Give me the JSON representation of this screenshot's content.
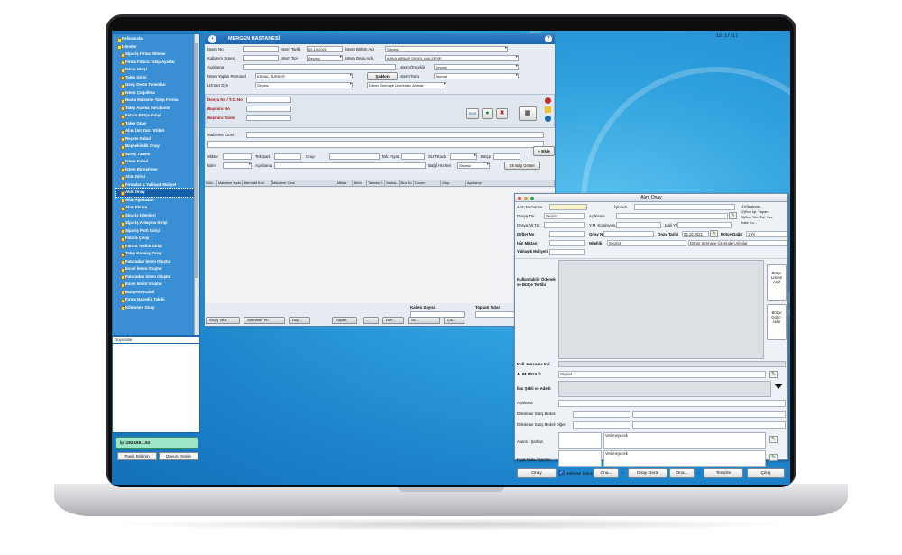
{
  "clock": "15:17:17",
  "nav": {
    "items": [
      {
        "label": "Referanslar",
        "root": true
      },
      {
        "label": "İşlemler",
        "root": true
      },
      {
        "label": "Sipariş Firma Ekleme"
      },
      {
        "label": "Firma Fatura Takip Ayarlar"
      },
      {
        "label": "İstem Girişi"
      },
      {
        "label": "Talep Girişi"
      },
      {
        "label": "Genç Deste Tanımları"
      },
      {
        "label": "İstem Çoğaltma"
      },
      {
        "label": "Hasta Malzeme Talep Formu"
      },
      {
        "label": "Talep Aşama Sorulandır"
      },
      {
        "label": "Fatura Bütçe Girişi"
      },
      {
        "label": "Talep Onay"
      },
      {
        "label": "Alım Üst Yazı / Etiket"
      },
      {
        "label": "Reçete Kabul"
      },
      {
        "label": "Başhekimlik Onay"
      },
      {
        "label": "Süreç Tanımı"
      },
      {
        "label": "İstem Kabul"
      },
      {
        "label": "İstem Birleştirme"
      },
      {
        "label": "Alım Girişi"
      },
      {
        "label": "Firmalar & Yaklaşık Maliyet"
      },
      {
        "label": "Alım Onay",
        "selected": true
      },
      {
        "label": "Alım Aşamaları"
      },
      {
        "label": "Alım Ekranı"
      },
      {
        "label": "Sipariş İşlemleri"
      },
      {
        "label": "Sipariş Anlaşma Girişi"
      },
      {
        "label": "Sipariş Parti Girişi"
      },
      {
        "label": "Fatura Çıkışı"
      },
      {
        "label": "Fatura Teslim Girişi"
      },
      {
        "label": "Talep Komisy Onay"
      },
      {
        "label": "Faturadan İstem Oluştur"
      },
      {
        "label": "Excel İstem Oluştur"
      },
      {
        "label": "Faturadan İstem Oluştur"
      },
      {
        "label": "Excel İstem Oluştur"
      },
      {
        "label": "Muayene Kabul"
      },
      {
        "label": "Firma Hakediş Takibi"
      },
      {
        "label": "Kilometre Onay"
      }
    ]
  },
  "notices_label": "Duyurular",
  "ip_label": "İp :192.168.1.54",
  "panic_button": "Panik Bildirim",
  "refresh_button": "Duyuru Yenile",
  "main": {
    "title": "MERGEN HASTANESİ",
    "fields": {
      "istem_no": "İstem No",
      "istem_tarihi": "İstem Tarihi",
      "istem_tarihi_val": "05.10.2021",
      "istem_bolum_adi": "İstem Bölüm Adı",
      "istem_bolum_val": "Seçiniz",
      "kullanim_suresi": "Kullanım Süresi",
      "istem_tipi": "İstem Tipi",
      "istem_tipi_val": "Seçiniz",
      "istem_depo_adi": "İstem Depo Adı",
      "istem_depo_val": "ANNA ARBAR GENEL MALZEME",
      "aciklama": "Açıklama",
      "istem_onceligi": "İstem Önceliği",
      "istem_onceligi_val": "Seçiniz",
      "istem_yapan": "İstem Yapan Personel",
      "istem_yapan_val": "KEMAL TÜRKER",
      "sablon": "Şablon",
      "istem_turu": "İstem Türü",
      "istem_turu_val": "Normal",
      "uzman_gyn": "Uzman Gyn",
      "uzman_val": "Seçiniz",
      "donor_val": "Döner Sermaye Üzerinden Alımlar",
      "dosya_no": "Dosya No / T.C. No",
      "basvuru_no": "Başvuru No",
      "basvuru_tarihi": "Başvuru Tarihi",
      "malzeme_cinsi": "Malzeme Cinsi",
      "miktar": "Miktar",
      "tek_sart": "Tek.Şart.",
      "grup": "Grup",
      "tah_fiyat": "Tah. Fiyat",
      "sut_kodu": "SUT Kodu",
      "butce": "Bütçe",
      "birim": "Birim",
      "aciklama2": "Açıklama",
      "bagli_hizmet": "Bağlı Hizmet",
      "bagli_val": "Seçiniz",
      "ek_bilgi": "Ek Bilgi Göster",
      "ekle": "Ekle",
      "sms": "SMS"
    },
    "grid_headers": [
      "Bölü...",
      "Malzeme Kodu",
      "Alternatif Kod",
      "Malzeme Cinsi",
      "Miktar",
      "Birim",
      "Tahmini F...",
      "Sartna...",
      "Sira No",
      "Durum",
      "Grup",
      "Açıklama"
    ],
    "kalem_sayisi": "Kalem Sayısı :",
    "toplam_tutar": "Toplam Tutar :",
    "tabs": [
      "Geçiş Tara...",
      "Sartname Ye...",
      "Dep...",
      "Kaydet",
      "...",
      "Den...",
      "Sil...",
      "Çık..."
    ]
  },
  "dialog": {
    "title": "Alım Onay",
    "alim_numarasi": "Alım Numarası",
    "isin_adi": "İşin Adı",
    "options": [
      "(1)Oluşturan",
      "(2)Son İşl. Yapan",
      "(3)Son Tek. Tal. Yaz.",
      "İhale Ko..."
    ],
    "dosya_tur": "Dosya Tür",
    "dosya_tur_val": "Seçiniz",
    "aciklama": "Açıklama",
    "dosya_alt_tur": "Dosya Alt Tür",
    "ym_komisyonu": "Y.M. Komisyonu",
    "mali_yil": "Mali Yıl",
    "defter_no": "Defter No",
    "onay_no": "Onay No",
    "onay_tarihi": "Onay Tarihi",
    "onay_tarihi_val": "05.10.2021",
    "butce_dagit": "Bütçe Dağıt",
    "butce_dagit_val": "1 Yıl",
    "isin_miktari": "İşin Miktarı",
    "niteligi": "Niteliği",
    "niteligi_val": "Seçiniz",
    "donor_val": "Döner Sermaye Üzerinden Alımlar",
    "yaklasik_maliyeti": "Yaklaşık Maliyeti",
    "kullanilabilir": "Kullanılabilir Ödenek ve Bütçe Tertibi",
    "butce_listesi": "Bütçe Listesi Aktif",
    "butce_guncelle": "Bütçe Günc-celle",
    "kull_harcama": "Kull. Harcama Kal...",
    "alim_usulu": "ALIM USULÜ",
    "alim_usulu_val": "Seçiniz",
    "ilan_sekli": "İlan Şekli ve Adedi",
    "aciklama2": "Açıklama",
    "dokuman_bedeli": "Döküman Satış Bedeli",
    "dokuman_bedeli_diger": "Döküman Satış Bedeli Diğer",
    "avans": "Avans / Şartları",
    "avans_val": "Verilmeyecek",
    "fiyat_farki": "Fiyat Farkı / Şartları",
    "fiyat_farki_val": "Verilmeyecek",
    "btn_onay": "Onay",
    "chk_malzeme": "Malzeme Listeli",
    "btn_ona1": "Ona...",
    "btn_onay_geri": "Onay Geral",
    "btn_ona2": "Ona...",
    "btn_temizle": "Temizle",
    "btn_cikis": "Çıkış"
  }
}
